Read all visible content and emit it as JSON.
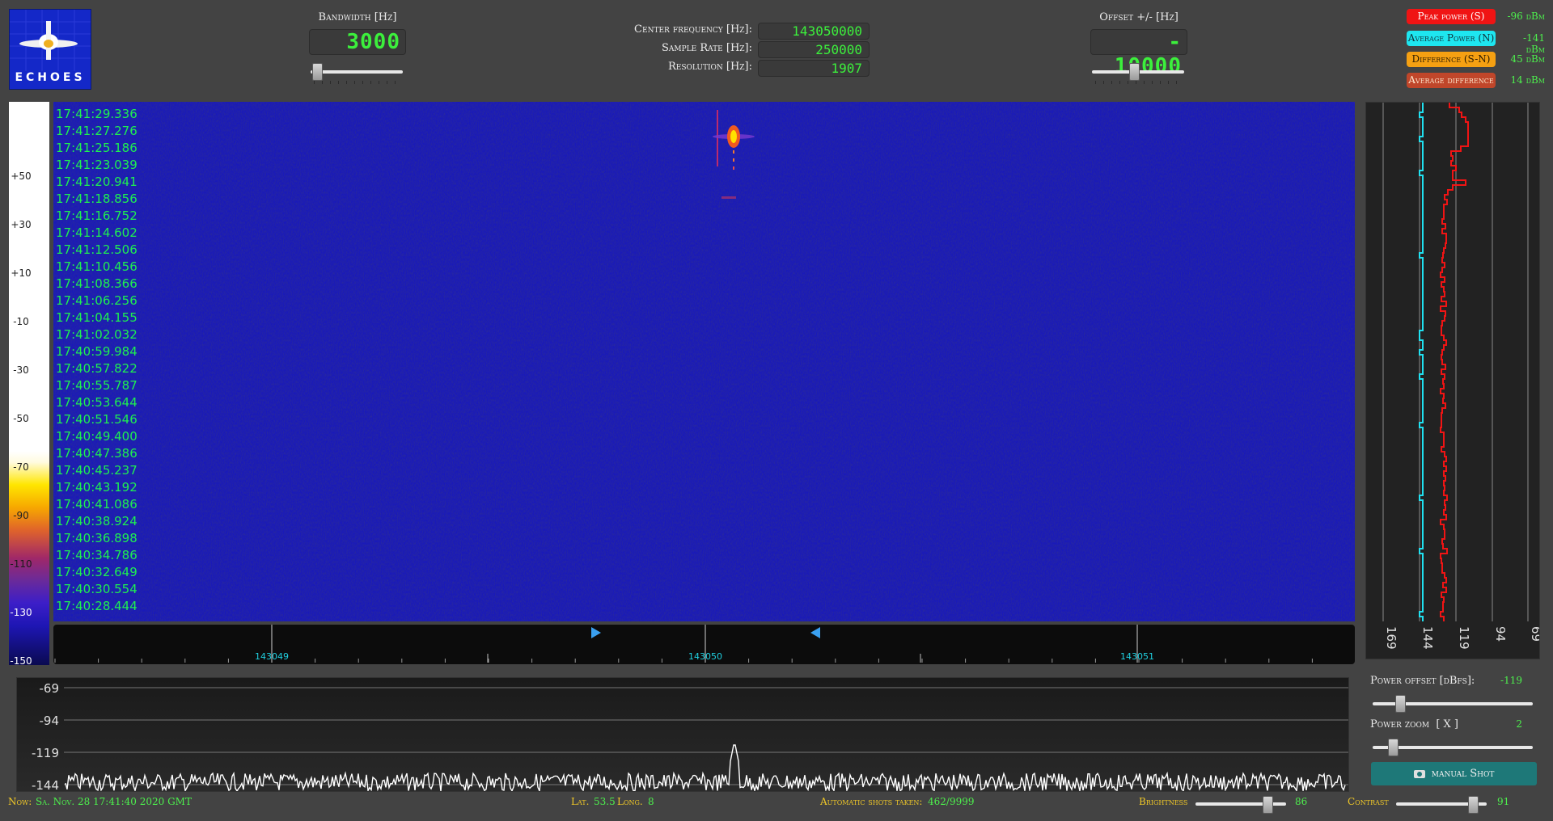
{
  "logo": {
    "text": "ECHOES"
  },
  "bandwidth": {
    "label": "Bandwidth [Hz]",
    "value": "3000",
    "slider_fraction": 0.02
  },
  "center": {
    "freq_label": "Center frequency [Hz]:",
    "freq_value": "143050000",
    "rate_label": "Sample Rate [Hz]:",
    "rate_value": "250000",
    "res_label": "Resolution [Hz]:",
    "res_value": "1907"
  },
  "offset": {
    "label": "Offset +/- [Hz]",
    "value": "- 10000",
    "slider_fraction": 0.45
  },
  "legend": [
    {
      "label": "Peak power (S)",
      "value": "-96 dBm",
      "color": "#f01414",
      "text_color": "#ffffff"
    },
    {
      "label": "Average Power (N)",
      "value": "-141 dBm",
      "color": "#1ee6f0",
      "text_color": "#10323a"
    },
    {
      "label": "Difference (S-N)",
      "value": "45 dBm",
      "color": "#f5a012",
      "text_color": "#2a1a00"
    },
    {
      "label": "Average difference",
      "value": "14 dBm",
      "color": "#c0462a",
      "text_color": "#ffe6cc"
    }
  ],
  "colorscale_ticks": [
    "+50",
    "+30",
    "+10",
    "-10",
    "-30",
    "-50",
    "-70",
    "-90",
    "-110",
    "-130",
    "-150"
  ],
  "timestamps": [
    "17:41:29.336",
    "17:41:27.276",
    "17:41:25.186",
    "17:41:23.039",
    "17:41:20.941",
    "17:41:18.856",
    "17:41:16.752",
    "17:41:14.602",
    "17:41:12.506",
    "17:41:10.456",
    "17:41:08.366",
    "17:41:06.256",
    "17:41:04.155",
    "17:41:02.032",
    "17:40:59.984",
    "17:40:57.822",
    "17:40:55.787",
    "17:40:53.644",
    "17:40:51.546",
    "17:40:49.400",
    "17:40:47.386",
    "17:40:45.237",
    "17:40:43.192",
    "17:40:41.086",
    "17:40:38.924",
    "17:40:36.898",
    "17:40:34.786",
    "17:40:32.649",
    "17:40:30.554",
    "17:40:28.444"
  ],
  "freq_scale": {
    "labels": [
      "143049",
      "143050",
      "143051"
    ]
  },
  "power_axis": {
    "labels": [
      "169",
      "144",
      "119",
      "94",
      "69"
    ]
  },
  "spectrum_axis": {
    "labels": [
      "-69",
      "-94",
      "-119",
      "-144"
    ]
  },
  "power_offset": {
    "label": "Power offset [dBfs]:",
    "value": "-119",
    "slider_fraction": 0.15
  },
  "power_zoom": {
    "label": "Power zoom  [ X ]",
    "value": "2",
    "slider_fraction": 0.1
  },
  "manual_shot": {
    "label": "manual Shot"
  },
  "status": {
    "now_label": "Now:",
    "now_value": "Sa. Nov. 28 17:41:40 2020 GMT",
    "lat_label": "Lat.",
    "lat_value": "53.5",
    "long_label": "Long.",
    "long_value": "8",
    "shots_label": "Automatic shots taken:",
    "shots_value": "462/9999",
    "brightness_label": "Brightness",
    "brightness_value": "86",
    "brightness_fraction": 0.82,
    "contrast_label": "Contrast",
    "contrast_value": "91",
    "contrast_fraction": 0.88
  }
}
